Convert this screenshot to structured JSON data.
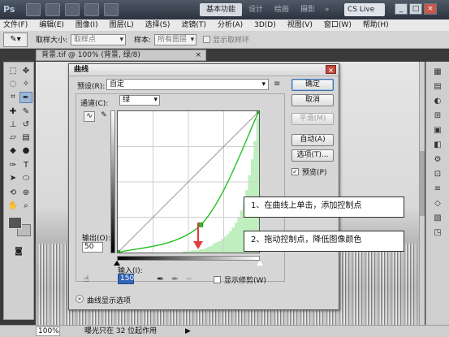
{
  "titlebar": {
    "logo": "Ps",
    "workspace_active": "基本功能",
    "workspace_links": [
      "设计",
      "绘画",
      "摄影"
    ],
    "workspace_more": "»",
    "cs_live": "CS Live",
    "window_controls": [
      "_",
      "□",
      "×"
    ]
  },
  "menubar": {
    "items": [
      "文件(F)",
      "编辑(E)",
      "图像(I)",
      "图层(L)",
      "选择(S)",
      "滤镜(T)",
      "分析(A)",
      "3D(D)",
      "视图(V)",
      "窗口(W)",
      "帮助(H)"
    ]
  },
  "options_bar": {
    "tool": "✎▾",
    "sample_size_label": "取样大小:",
    "sample_size_value": "取样点",
    "sample_label": "样本:",
    "sample_value": "所有图层",
    "show_ring_label": "显示取样环"
  },
  "document": {
    "tab_title": "背景.tif @ 100% (背景, 绿/8)",
    "tab_close": "×"
  },
  "statusbar": {
    "zoom": "100%",
    "info": "曝光只在 32 位起作用",
    "arrow": "▶"
  },
  "curves_dialog": {
    "title": "曲线",
    "close": "×",
    "preset_label": "预设(R):",
    "preset_value": "自定",
    "preset_menu_icon": "≡",
    "buttons": {
      "ok": "确定",
      "cancel": "取消",
      "smooth": "平滑(M)",
      "auto": "自动(A)",
      "options": "选项(T)..."
    },
    "preview_label": "预览(P)",
    "preview_checked": true,
    "preview_mark": "✓",
    "channel_label": "通道(C):",
    "channel_value": "绿",
    "curve_mode_icon": "∿",
    "pencil_mode_icon": "✎",
    "hand_icon": "☝",
    "eyedropper_icons": [
      "✒",
      "✒",
      "✒"
    ],
    "output_label": "输出(O):",
    "output_value": "50",
    "input_label": "输入(I):",
    "input_value": "150",
    "show_clipping_label": "显示修剪(W)",
    "curve_display_options": "曲线显示选项",
    "expand_icon": "»"
  },
  "chart_data": {
    "type": "line",
    "xlim": [
      0,
      255
    ],
    "ylim": [
      0,
      255
    ],
    "grid": true,
    "control_points": [
      [
        0,
        0
      ],
      [
        150,
        50
      ],
      [
        255,
        255
      ]
    ],
    "diagonal": [
      [
        0,
        0
      ],
      [
        255,
        255
      ]
    ],
    "curve_color": "#22c222",
    "histogram_color": "#bfeebf",
    "histogram": [
      0,
      0,
      0,
      0,
      0,
      0,
      0,
      0,
      0,
      0,
      0,
      0,
      0,
      0,
      0,
      0,
      0,
      0,
      0,
      0,
      0,
      0,
      0,
      0,
      1,
      1,
      1,
      2,
      2,
      2,
      3,
      3,
      4,
      5,
      6,
      8,
      9,
      10,
      12,
      14,
      16,
      19,
      22,
      26,
      31,
      37,
      45,
      55,
      68,
      82,
      98,
      118
    ]
  },
  "annotations": {
    "callout_1": "1、在曲线上单击，添加控制点",
    "callout_2": "2、拖动控制点，降低图像颜色",
    "arrow_color": "#e23c3c"
  },
  "panel_strip": {
    "icons": [
      "▦",
      "▤",
      "◐",
      "⊞",
      "▣",
      "◧",
      "⚙",
      "⊡",
      "≡",
      "◇",
      "▧",
      "◳"
    ]
  }
}
